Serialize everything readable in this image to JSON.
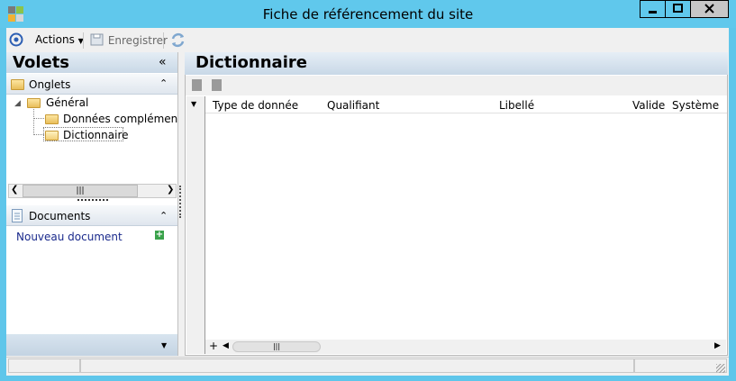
{
  "window": {
    "title": "Fiche de référencement du site",
    "min_symbol": "—",
    "max_symbol": "□",
    "close_symbol": "✕"
  },
  "toolbar": {
    "actions_label": "Actions",
    "save_label": "Enregistrer"
  },
  "left_panel": {
    "title": "Volets",
    "collapse_symbol": "«",
    "onglets": {
      "label": "Onglets",
      "tree": {
        "root": "Général",
        "children": [
          "Données complémentair",
          "Dictionnaire"
        ]
      }
    },
    "documents": {
      "label": "Documents",
      "new_document": "Nouveau document"
    }
  },
  "main": {
    "title": "Dictionnaire",
    "columns": [
      "Type de donnée",
      "Qualifiant",
      "Libellé",
      "Valide",
      "Système"
    ],
    "add_row_symbol": "+"
  },
  "colors": {
    "titlebar": "#60c8ec",
    "header_gradient_top": "#e6eef6",
    "header_gradient_bottom": "#c8d8e7",
    "link": "#1a2a8c",
    "add_green": "#3aa24b"
  }
}
